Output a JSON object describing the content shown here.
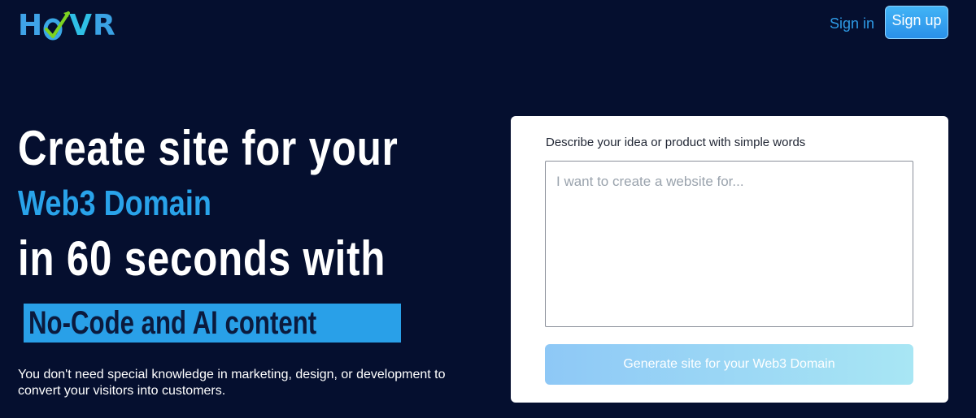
{
  "header": {
    "logo_letters": [
      "H",
      "o",
      "V",
      "R"
    ],
    "logo_text": "HoVR",
    "signin_label": "Sign in",
    "signup_label": "Sign up"
  },
  "hero": {
    "line1": "Create site for your",
    "line2": "Web3 Domain",
    "line3": "in 60 seconds with",
    "line4": "No-Code and AI content",
    "subtext": "You don't need special knowledge in marketing, design, or development to convert your visitors into customers."
  },
  "form": {
    "label": "Describe your idea or product with simple words",
    "textarea_placeholder": "I want to create a website for...",
    "button_label": "Generate site for your Web3 Domain"
  },
  "colors": {
    "background": "#050f2f",
    "accent": "#29a3ea",
    "logo_check": "#7ed321"
  }
}
